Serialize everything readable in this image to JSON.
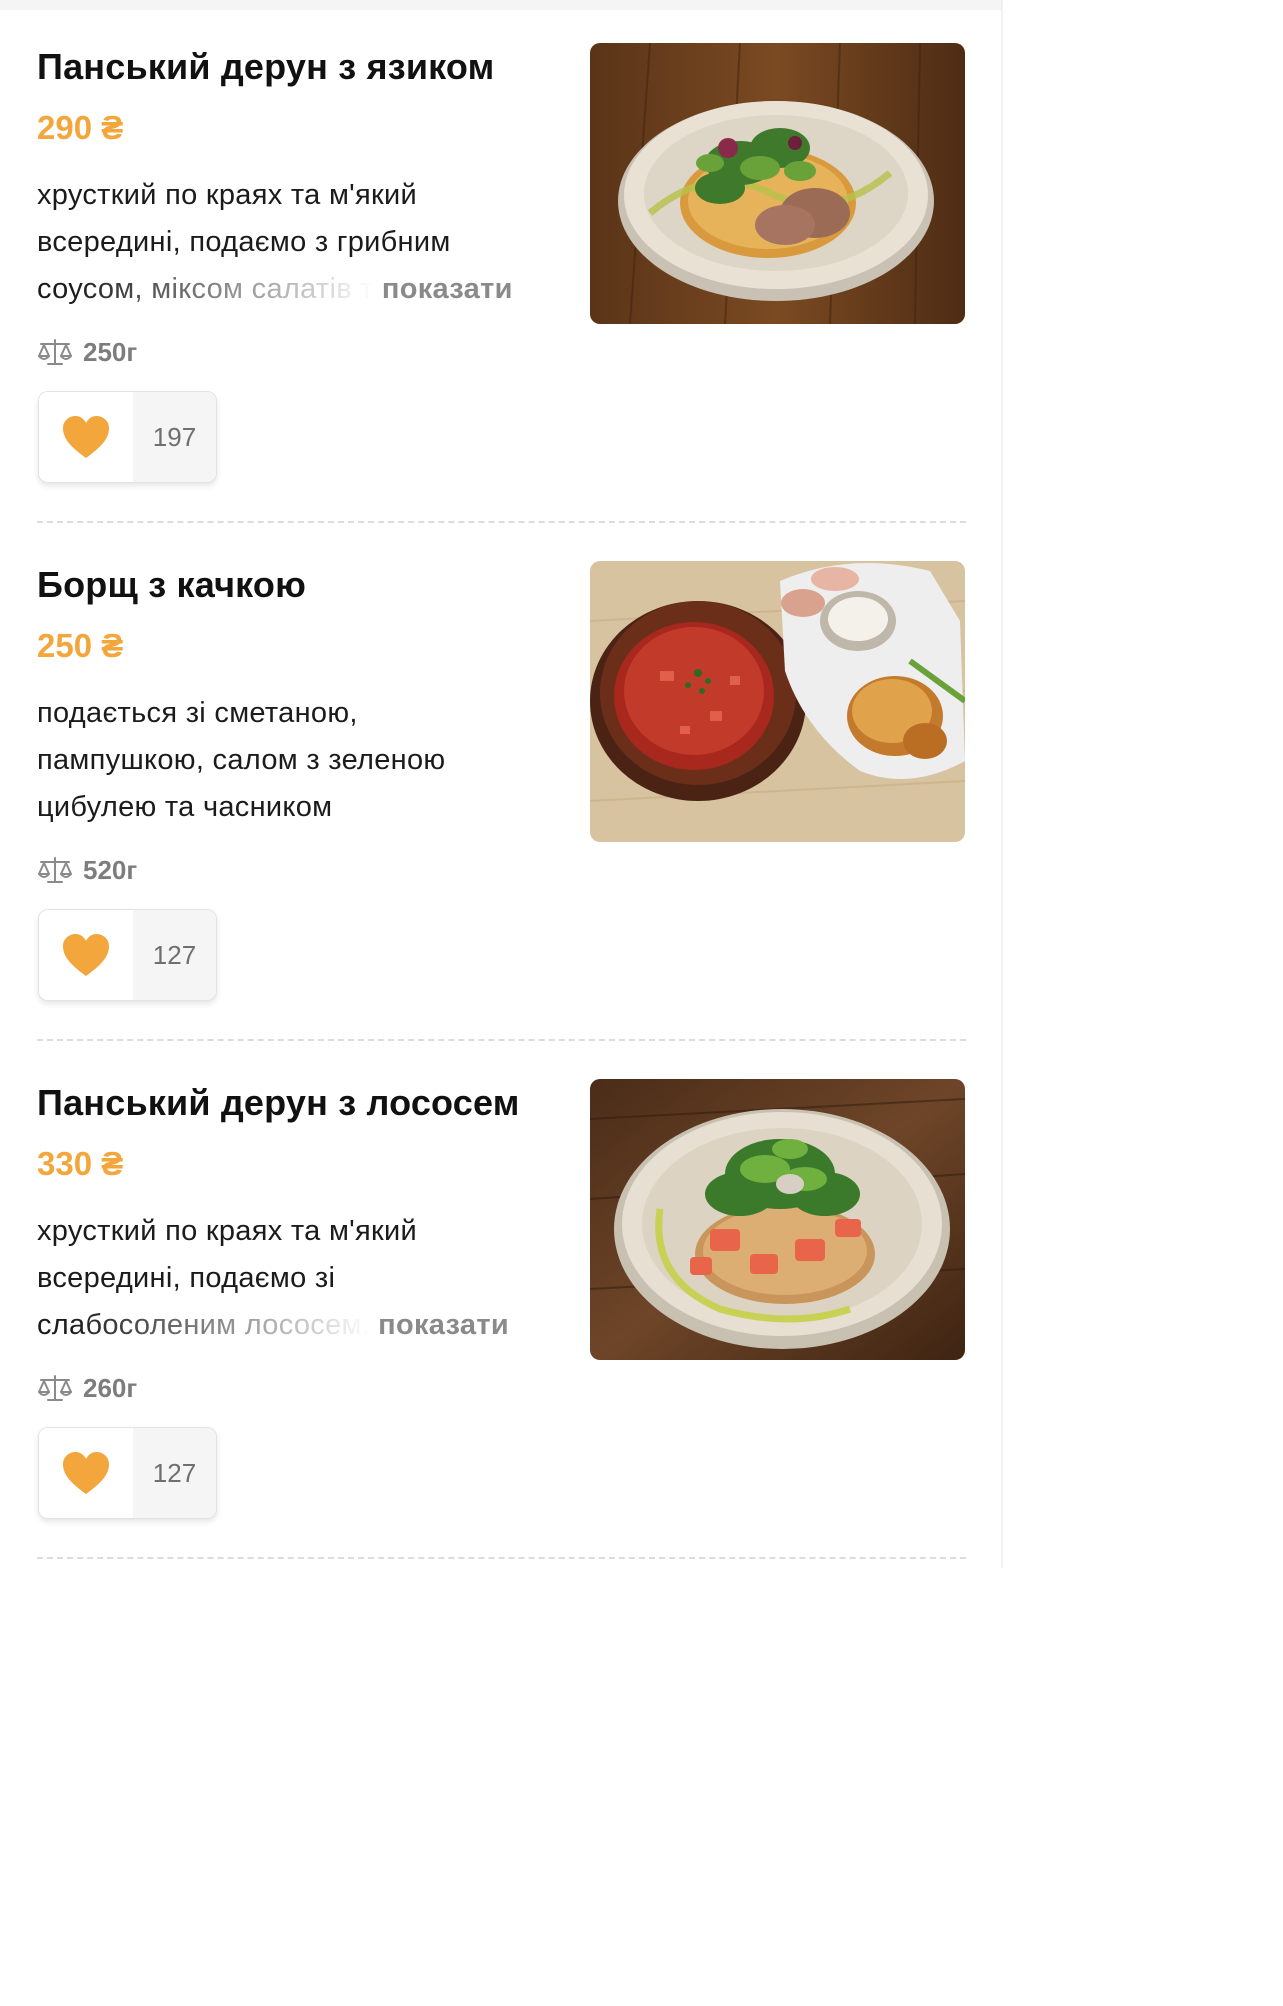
{
  "items": [
    {
      "title": "Панський дерун з язиком",
      "price": "290 ₴",
      "description_lines": [
        "хрусткий по краях та м'який",
        "всередині, подаємо з грибним"
      ],
      "description_faded": "соусом, міксом салатів т",
      "show_more_label": "показати",
      "weight": "250г",
      "likes": "197",
      "photo_icon": "plate-with-draniki-and-tongue"
    },
    {
      "title": "Борщ з качкою",
      "price": "250 ₴",
      "description_lines": [
        "подається зі сметаною,",
        "пампушкою, салом з зеленою",
        "цибулею та часником"
      ],
      "weight": "520г",
      "likes": "127",
      "photo_icon": "borscht-bowl-with-sides"
    },
    {
      "title": "Панський дерун з лососем",
      "price": "330 ₴",
      "description_lines": [
        "хрусткий по краях та м'який",
        "всередині, подаємо зі"
      ],
      "description_faded": "слабосоленим лососем,",
      "show_more_label": "показати",
      "weight": "260г",
      "likes": "127",
      "photo_icon": "plate-with-draniki-and-salmon"
    }
  ],
  "colors": {
    "price": "#f2a63b",
    "heart": "#f2a63b",
    "muted": "#7d7d7d",
    "divider": "#dcdcdc"
  },
  "icons": [
    "scale-icon",
    "heart-icon"
  ]
}
